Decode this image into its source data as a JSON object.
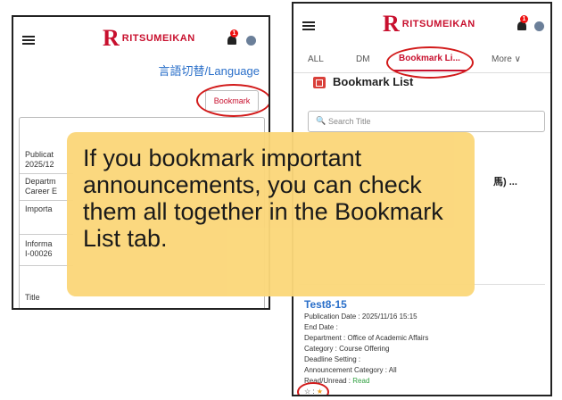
{
  "screen1": {
    "logo_text": "RITSUMEIKAN",
    "bell_badge": "1",
    "language_link": "言語切替/Language",
    "bookmark_button": "Bookmark",
    "fields": [
      {
        "label": "Publicat",
        "value": "2025/12"
      },
      {
        "label": "Departm",
        "value": "Career E"
      },
      {
        "label": "Importa",
        "value": ""
      },
      {
        "label": "Informa",
        "value": "I-00026"
      },
      {
        "label": "Title",
        "value": ""
      }
    ]
  },
  "screen2": {
    "logo_text": "RITSUMEIKAN",
    "bell_badge": "1",
    "tabs": [
      "ALL",
      "DM",
      "Bookmark Li..."
    ],
    "more_label": "More",
    "section_title": "Bookmark List",
    "search_placeholder": "Search Title",
    "partial_item_title": "馬) ...",
    "item": {
      "title": "Test8-15",
      "publication": "Publication Date : 2025/11/16 15:15",
      "end_date": "End Date :",
      "department": "Department : Office of Academic Affairs",
      "category": "Category : Course Offering",
      "deadline": "Deadline Setting :",
      "announcement_category": "Announcement Category : All",
      "read_label": "Read/Unread : ",
      "read_value": "Read",
      "star_label": "☆ : ",
      "star_value": "★"
    }
  },
  "callout_text": "If you bookmark important announcements, you can check them all together in the Bookmark List tab.",
  "colors": {
    "brand_red": "#c8102e",
    "link_blue": "#2a6fc9",
    "callout": "#fbd77a",
    "read_green": "#2e9e3e",
    "star_orange": "#f0a020"
  }
}
